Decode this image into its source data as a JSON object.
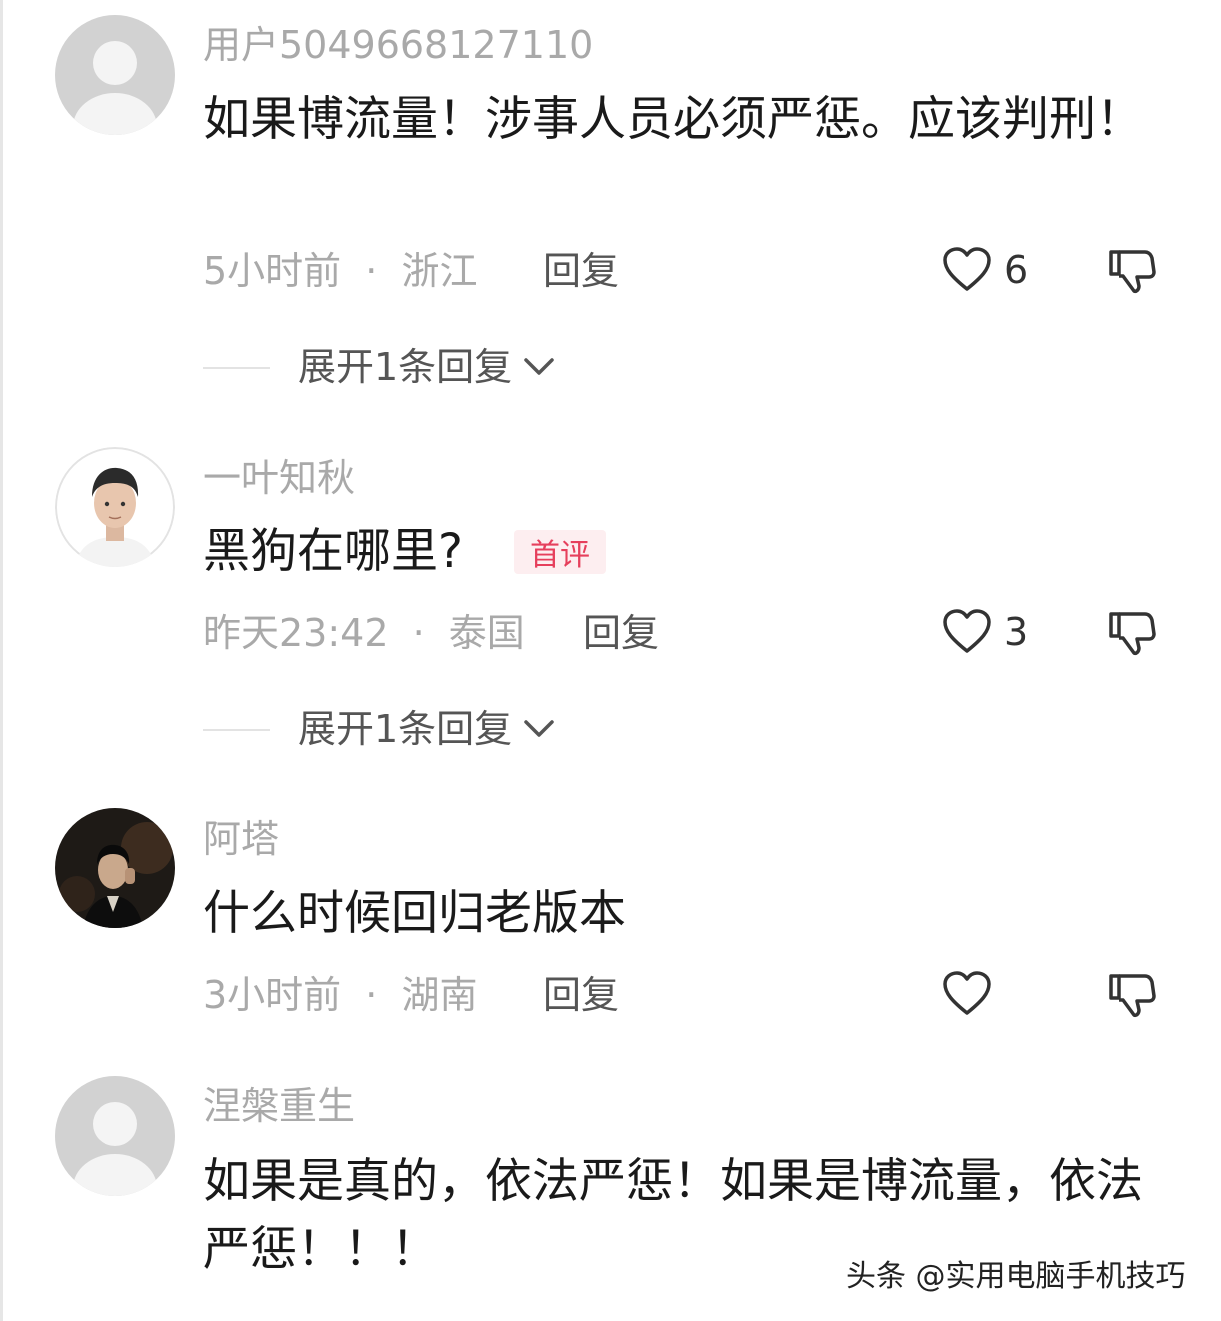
{
  "comments": [
    {
      "username": "用户5049668127110",
      "avatar_icon": "default-avatar-icon",
      "text": "如果博流量！涉事人员必须严惩。应该判刑！",
      "time": "5小时前",
      "location": "浙江",
      "separator": "·",
      "reply_label": "回复",
      "like_count": "6",
      "expand_label": "展开1条回复"
    },
    {
      "username": "一叶知秋",
      "avatar_icon": "user-photo-avatar",
      "text": "黑狗在哪里?",
      "badge": "首评",
      "time": "昨天23:42",
      "location": "泰国",
      "separator": "·",
      "reply_label": "回复",
      "like_count": "3",
      "expand_label": "展开1条回复"
    },
    {
      "username": "阿塔",
      "avatar_icon": "user-photo-avatar",
      "text": "什么时候回归老版本",
      "time": "3小时前",
      "location": "湖南",
      "separator": "·",
      "reply_label": "回复",
      "like_count": ""
    },
    {
      "username": "涅槃重生",
      "avatar_icon": "default-avatar-icon",
      "text": "如果是真的，依法严惩！如果是博流量，依法严惩！！！"
    }
  ],
  "watermark": "头条 @实用电脑手机技巧",
  "colors": {
    "meta_gray": "#a9a9a9",
    "badge_text": "#e63f5c",
    "badge_bg": "#fdeef0"
  }
}
